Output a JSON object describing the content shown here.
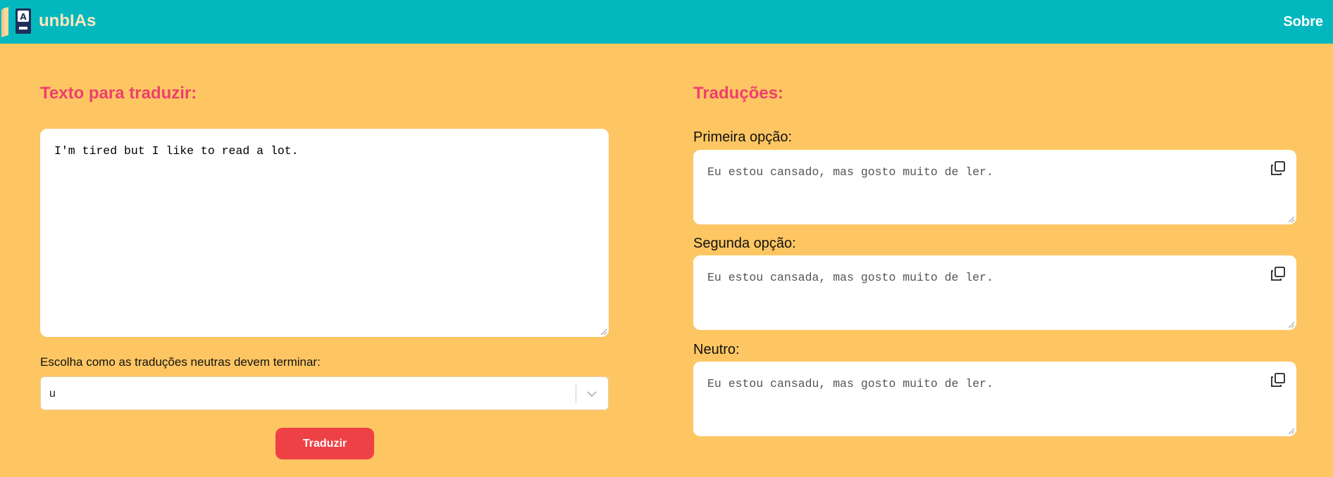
{
  "header": {
    "brand": "unbIAs",
    "about_link": "Sobre",
    "logo_icon": "book-translate-icon",
    "colors": {
      "bar": "#02B8BE",
      "brand_text": "#FFE7BC"
    }
  },
  "left": {
    "title": "Texto para traduzir:",
    "source_text": "I'm tired but I like to read a lot.",
    "ending_label": "Escolha como as traduções neutras devem terminar:",
    "ending_select": {
      "value": "u",
      "icon": "chevron-down-icon"
    },
    "translate_button": "Traduzir"
  },
  "right": {
    "title": "Traduções:",
    "options": [
      {
        "label": "Primeira opção:",
        "text": "Eu estou cansado, mas gosto muito de ler.",
        "icon": "copy-icon"
      },
      {
        "label": "Segunda opção:",
        "text": "Eu estou cansada, mas gosto muito de ler.",
        "icon": "copy-icon"
      },
      {
        "label": "Neutro:",
        "text": "Eu estou cansadu, mas gosto muito de ler.",
        "icon": "copy-icon"
      }
    ]
  },
  "colors": {
    "background": "#FEC662",
    "title": "#EE3F6F",
    "button": "#EE4145"
  }
}
